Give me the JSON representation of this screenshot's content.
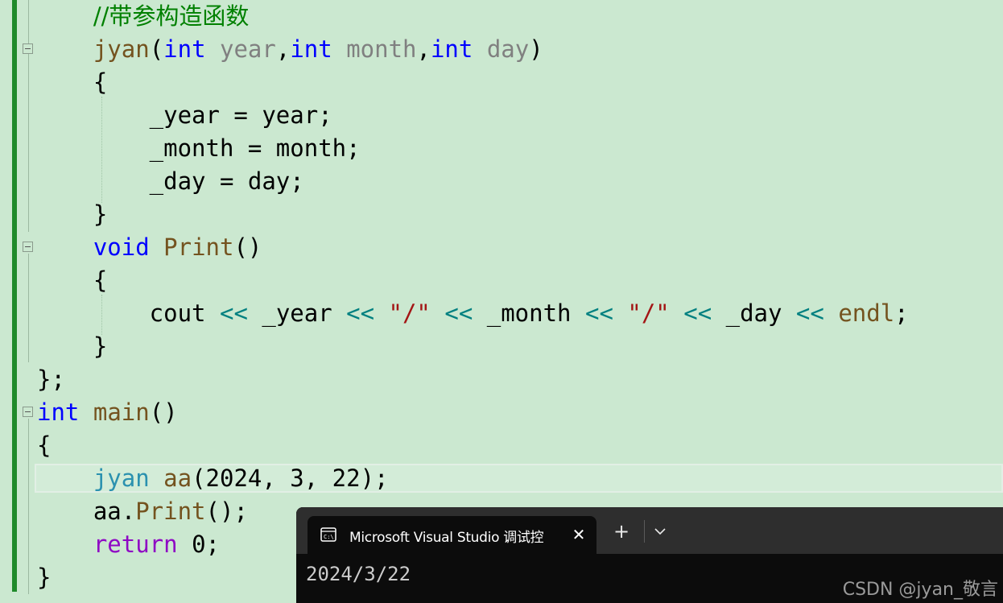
{
  "editor": {
    "lines": [
      [
        {
          "t": "    ",
          "c": "plain"
        },
        {
          "t": "//带参构造函数",
          "c": "comment"
        }
      ],
      [
        {
          "t": "    ",
          "c": "plain"
        },
        {
          "t": "jyan",
          "c": "fn"
        },
        {
          "t": "(",
          "c": "plain"
        },
        {
          "t": "int",
          "c": "kw"
        },
        {
          "t": " ",
          "c": "plain"
        },
        {
          "t": "year",
          "c": "param"
        },
        {
          "t": ",",
          "c": "plain"
        },
        {
          "t": "int",
          "c": "kw"
        },
        {
          "t": " ",
          "c": "plain"
        },
        {
          "t": "month",
          "c": "param"
        },
        {
          "t": ",",
          "c": "plain"
        },
        {
          "t": "int",
          "c": "kw"
        },
        {
          "t": " ",
          "c": "plain"
        },
        {
          "t": "day",
          "c": "param"
        },
        {
          "t": ")",
          "c": "plain"
        }
      ],
      [
        {
          "t": "    {",
          "c": "plain"
        }
      ],
      [
        {
          "t": "        _year = year;",
          "c": "plain"
        }
      ],
      [
        {
          "t": "        _month = month;",
          "c": "plain"
        }
      ],
      [
        {
          "t": "        _day = day;",
          "c": "plain"
        }
      ],
      [
        {
          "t": "    }",
          "c": "plain"
        }
      ],
      [
        {
          "t": "    ",
          "c": "plain"
        },
        {
          "t": "void",
          "c": "kw"
        },
        {
          "t": " ",
          "c": "plain"
        },
        {
          "t": "Print",
          "c": "fn"
        },
        {
          "t": "()",
          "c": "plain"
        }
      ],
      [
        {
          "t": "    {",
          "c": "plain"
        }
      ],
      [
        {
          "t": "        cout ",
          "c": "plain"
        },
        {
          "t": "<<",
          "c": "op"
        },
        {
          "t": " _year ",
          "c": "plain"
        },
        {
          "t": "<<",
          "c": "op"
        },
        {
          "t": " ",
          "c": "plain"
        },
        {
          "t": "\"/\"",
          "c": "str"
        },
        {
          "t": " ",
          "c": "plain"
        },
        {
          "t": "<<",
          "c": "op"
        },
        {
          "t": " _month ",
          "c": "plain"
        },
        {
          "t": "<<",
          "c": "op"
        },
        {
          "t": " ",
          "c": "plain"
        },
        {
          "t": "\"/\"",
          "c": "str"
        },
        {
          "t": " ",
          "c": "plain"
        },
        {
          "t": "<<",
          "c": "op"
        },
        {
          "t": " _day ",
          "c": "plain"
        },
        {
          "t": "<<",
          "c": "op"
        },
        {
          "t": " ",
          "c": "plain"
        },
        {
          "t": "endl",
          "c": "fn"
        },
        {
          "t": ";",
          "c": "plain"
        }
      ],
      [
        {
          "t": "    }",
          "c": "plain"
        }
      ],
      [
        {
          "t": "};",
          "c": "plain"
        }
      ],
      [
        {
          "t": "int",
          "c": "kw"
        },
        {
          "t": " ",
          "c": "plain"
        },
        {
          "t": "main",
          "c": "fn"
        },
        {
          "t": "()",
          "c": "plain"
        }
      ],
      [
        {
          "t": "{",
          "c": "plain"
        }
      ],
      [
        {
          "t": "    ",
          "c": "plain"
        },
        {
          "t": "jyan",
          "c": "type"
        },
        {
          "t": " ",
          "c": "plain"
        },
        {
          "t": "aa",
          "c": "fn"
        },
        {
          "t": "(2024, 3, 22);",
          "c": "plain"
        }
      ],
      [
        {
          "t": "    aa.",
          "c": "plain"
        },
        {
          "t": "Print",
          "c": "fn"
        },
        {
          "t": "();",
          "c": "plain"
        }
      ],
      [
        {
          "t": "    ",
          "c": "plain"
        },
        {
          "t": "return",
          "c": "kw2"
        },
        {
          "t": " 0;",
          "c": "plain"
        }
      ],
      [
        {
          "t": "}",
          "c": "plain"
        }
      ]
    ]
  },
  "terminal": {
    "tab_title": "Microsoft Visual Studio 调试控",
    "close_glyph": "✕",
    "new_tab_glyph": "+",
    "output": "2024/3/22"
  },
  "watermark": "CSDN @jyan_敬言",
  "colors": {
    "background": "#cbe8d0",
    "keyword": "#0000ff",
    "return_keyword": "#8f08c4",
    "function": "#74531f",
    "parameter": "#808080",
    "operator": "#008080",
    "string": "#a31515",
    "comment": "#008000",
    "type": "#2b91af",
    "change_bar": "#1f8a2a"
  },
  "icons": [
    "console-app-icon",
    "close-icon",
    "plus-icon",
    "chevron-down-icon",
    "fold-collapse-icon"
  ]
}
